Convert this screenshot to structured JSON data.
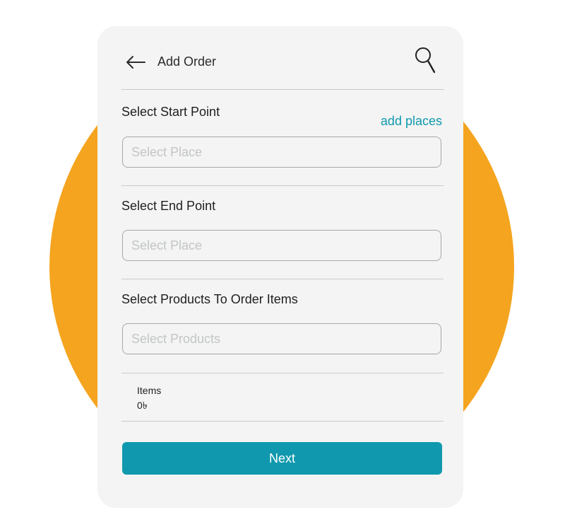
{
  "colors": {
    "accent": "#1099ae",
    "background_circle": "#f5a41f",
    "card": "#f3f4f3"
  },
  "header": {
    "back_icon": "arrow-left-icon",
    "title": "Add Order",
    "search_icon": "magnifier-icon"
  },
  "start_point": {
    "label": "Select Start Point",
    "add_places_link": "add places",
    "placeholder": "Select Place",
    "value": ""
  },
  "end_point": {
    "label": "Select End Point",
    "placeholder": "Select Place",
    "value": ""
  },
  "products": {
    "label": "Select Products To Order Items",
    "placeholder": "Select Products",
    "value": ""
  },
  "summary": {
    "items_label": "Items",
    "items_value": "0৳"
  },
  "footer": {
    "next_label": "Next"
  }
}
